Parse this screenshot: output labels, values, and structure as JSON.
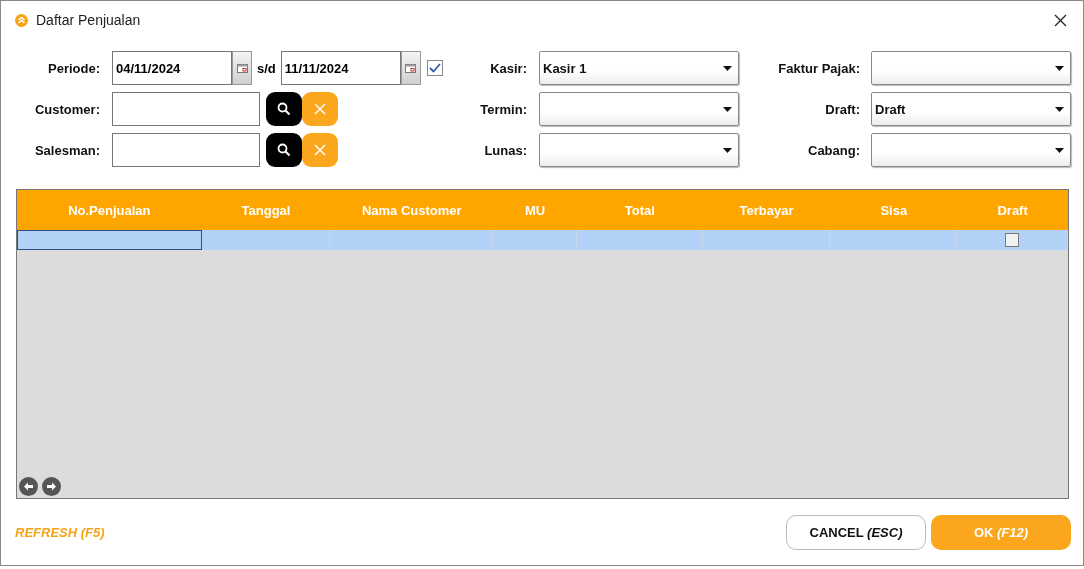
{
  "window": {
    "title": "Daftar Penjualan"
  },
  "periode": {
    "label": "Periode:",
    "from": "04/11/2024",
    "separator": "s/d",
    "to": "11/11/2024",
    "checked": true
  },
  "lookups": [
    {
      "label": "Customer:"
    },
    {
      "label": "Salesman:"
    }
  ],
  "selects_middle": [
    {
      "label": "Kasir:",
      "value": "Kasir 1"
    },
    {
      "label": "Termin:"
    },
    {
      "label": "Lunas:"
    }
  ],
  "selects_right": [
    {
      "label": "Faktur Pajak:"
    },
    {
      "label": "Draft:",
      "value": "Draft"
    },
    {
      "label": "Cabang:"
    }
  ],
  "table": {
    "columns": [
      "No.Penjualan",
      "Tanggal",
      "Nama Customer",
      "MU",
      "Total",
      "Terbayar",
      "Sisa",
      "Draft"
    ],
    "rows": [
      {
        "selected": true,
        "draft_checked": false
      }
    ]
  },
  "footer": {
    "refresh": "REFRESH (F5)",
    "cancel": "CANCEL *(ESC)*",
    "ok": "OK *(F12)*"
  }
}
